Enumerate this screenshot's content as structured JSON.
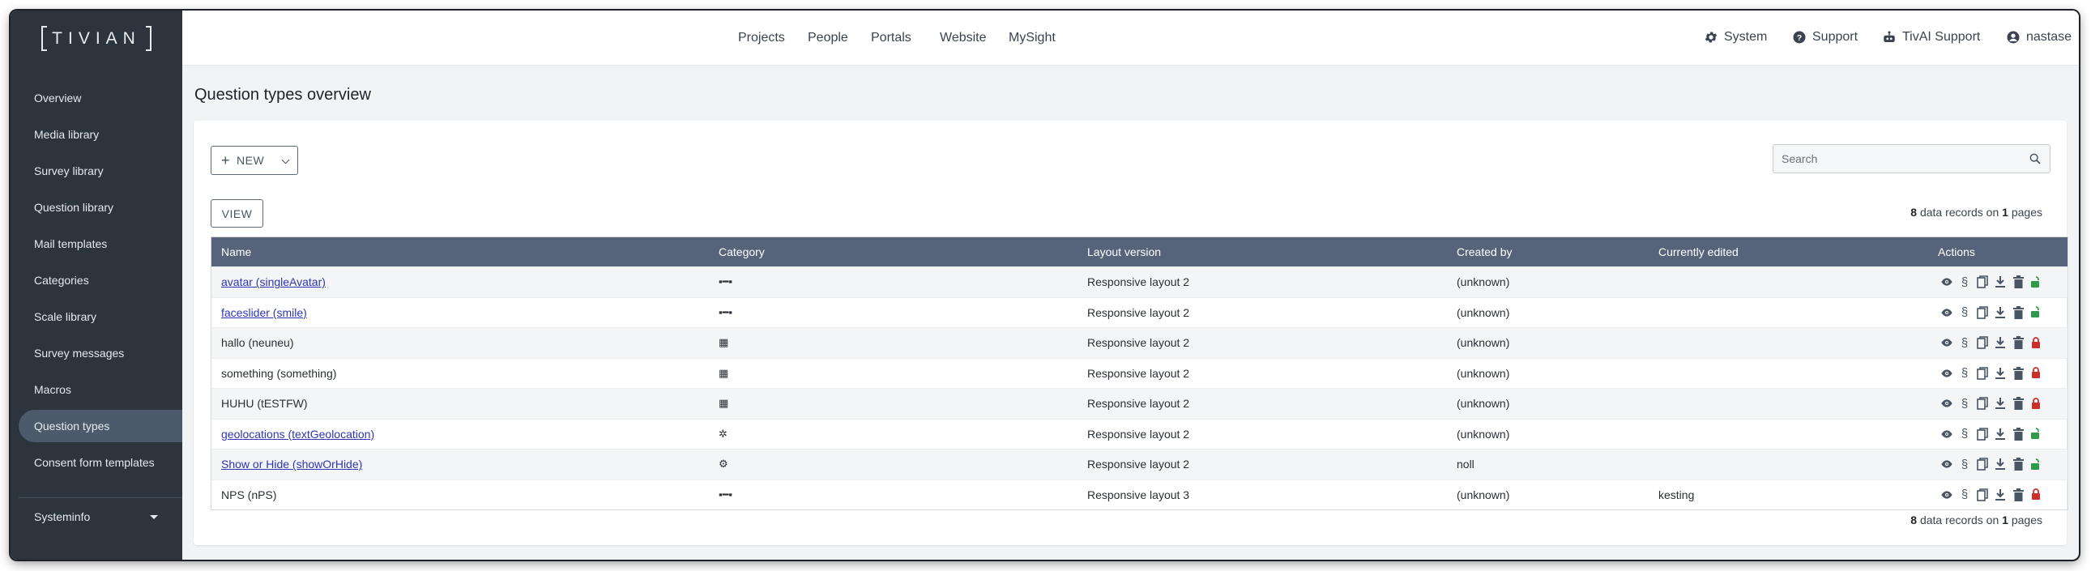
{
  "logo_text": "TIVIAN",
  "sidebar": {
    "items": [
      {
        "label": "Overview"
      },
      {
        "label": "Media library"
      },
      {
        "label": "Survey library"
      },
      {
        "label": "Question library"
      },
      {
        "label": "Mail templates"
      },
      {
        "label": "Categories"
      },
      {
        "label": "Scale library"
      },
      {
        "label": "Survey messages"
      },
      {
        "label": "Macros"
      },
      {
        "label": "Question types",
        "active": true
      },
      {
        "label": "Consent form templates"
      }
    ],
    "systeminfo": "Systeminfo"
  },
  "topnav": [
    "Projects",
    "People",
    "Portals",
    "Website",
    "MySight"
  ],
  "utils": {
    "system": "System",
    "support": "Support",
    "tivai": "TivAI Support",
    "user": "nastase"
  },
  "page": {
    "title": "Question types overview",
    "new_label": "NEW",
    "view_label": "VIEW",
    "search_placeholder": "Search",
    "records": {
      "count": "8",
      "mid": "data records on",
      "pages": "1",
      "end": "pages"
    }
  },
  "table": {
    "headers": [
      "Name",
      "Category",
      "Layout version",
      "Created by",
      "Currently edited",
      "Actions"
    ],
    "rows": [
      {
        "name": "avatar (singleAvatar)",
        "link": true,
        "category_icon": "slider-icon",
        "category_glyph": "▪━▪",
        "layout": "Responsive layout 2",
        "created_by": "(unknown)",
        "edited": "",
        "lock": "unlocked"
      },
      {
        "name": "faceslider (smile)",
        "link": true,
        "category_icon": "slider-icon",
        "category_glyph": "▪━▪",
        "layout": "Responsive layout 2",
        "created_by": "(unknown)",
        "edited": "",
        "lock": "unlocked"
      },
      {
        "name": "hallo (neuneu)",
        "link": false,
        "category_icon": "grid-icon",
        "category_glyph": "▦",
        "layout": "Responsive layout 2",
        "created_by": "(unknown)",
        "edited": "",
        "lock": "locked"
      },
      {
        "name": "something (something)",
        "link": false,
        "category_icon": "grid-icon",
        "category_glyph": "▦",
        "layout": "Responsive layout 2",
        "created_by": "(unknown)",
        "edited": "",
        "lock": "locked"
      },
      {
        "name": "HUHU (tESTFW)",
        "link": false,
        "category_icon": "grid-icon",
        "category_glyph": "▦",
        "layout": "Responsive layout 2",
        "created_by": "(unknown)",
        "edited": "",
        "lock": "locked"
      },
      {
        "name": "geolocations (textGeolocation)",
        "link": true,
        "category_icon": "sparkle-icon",
        "category_glyph": "✲",
        "layout": "Responsive layout 2",
        "created_by": "(unknown)",
        "edited": "",
        "lock": "unlocked"
      },
      {
        "name": "Show or Hide (showOrHide)",
        "link": true,
        "category_icon": "gears-icon",
        "category_glyph": "⚙",
        "layout": "Responsive layout 2",
        "created_by": "noll",
        "edited": "",
        "lock": "unlocked"
      },
      {
        "name": "NPS (nPS)",
        "link": false,
        "category_icon": "slider-icon",
        "category_glyph": "▪━▪",
        "layout": "Responsive layout 3",
        "created_by": "(unknown)",
        "edited": "kesting",
        "lock": "locked"
      }
    ]
  },
  "colors": {
    "sidebar_bg": "#2c343e",
    "header_bg": "#56637a",
    "link": "#2e36b3",
    "lock_open": "#2e9b4b",
    "lock_closed": "#c9302c"
  }
}
